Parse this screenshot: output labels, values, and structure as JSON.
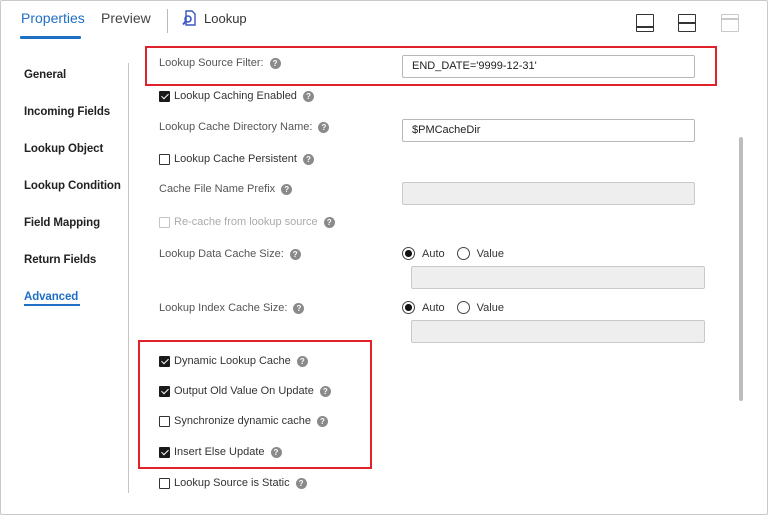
{
  "tabs": [
    {
      "label": "Properties",
      "active": true
    },
    {
      "label": "Preview",
      "active": false
    }
  ],
  "object": {
    "icon": "lookup-transformation-icon",
    "title": "Lookup"
  },
  "layout_buttons": [
    {
      "icon": "layout-single-pane-icon",
      "enabled": true
    },
    {
      "icon": "layout-split-horizontal-icon",
      "enabled": true
    },
    {
      "icon": "layout-full-pane-icon",
      "enabled": false
    }
  ],
  "sidebar": {
    "items": [
      {
        "label": "General"
      },
      {
        "label": "Incoming Fields"
      },
      {
        "label": "Lookup Object"
      },
      {
        "label": "Lookup Condition"
      },
      {
        "label": "Field Mapping"
      },
      {
        "label": "Return Fields"
      },
      {
        "label": "Advanced",
        "active": true
      }
    ]
  },
  "form": {
    "source_filter": {
      "label": "Lookup Source Filter:",
      "value": "END_DATE='9999-12-31'"
    },
    "caching_enabled": {
      "label": "Lookup Caching Enabled",
      "checked": true
    },
    "cache_dir": {
      "label": "Lookup Cache Directory Name:",
      "value": "$PMCacheDir"
    },
    "cache_persistent": {
      "label": "Lookup Cache Persistent",
      "checked": false
    },
    "cache_prefix": {
      "label": "Cache File Name Prefix",
      "value": ""
    },
    "recache": {
      "label": "Re-cache from lookup source",
      "checked": false,
      "enabled": false
    },
    "data_cache_size": {
      "label": "Lookup Data Cache Size:",
      "options": [
        "Auto",
        "Value"
      ],
      "selected": "Auto",
      "value": ""
    },
    "index_cache_size": {
      "label": "Lookup Index Cache Size:",
      "options": [
        "Auto",
        "Value"
      ],
      "selected": "Auto",
      "value": ""
    },
    "dynamic_cache": {
      "label": "Dynamic Lookup Cache",
      "checked": true
    },
    "output_old_value": {
      "label": "Output Old Value On Update",
      "checked": true
    },
    "sync_dynamic_cache": {
      "label": "Synchronize dynamic cache",
      "checked": false
    },
    "insert_else_update": {
      "label": "Insert Else Update",
      "checked": true
    },
    "source_is_static": {
      "label": "Lookup Source is Static",
      "checked": false
    }
  },
  "colors": {
    "accent": "#1f6fc5",
    "highlight": "#e0222b"
  }
}
